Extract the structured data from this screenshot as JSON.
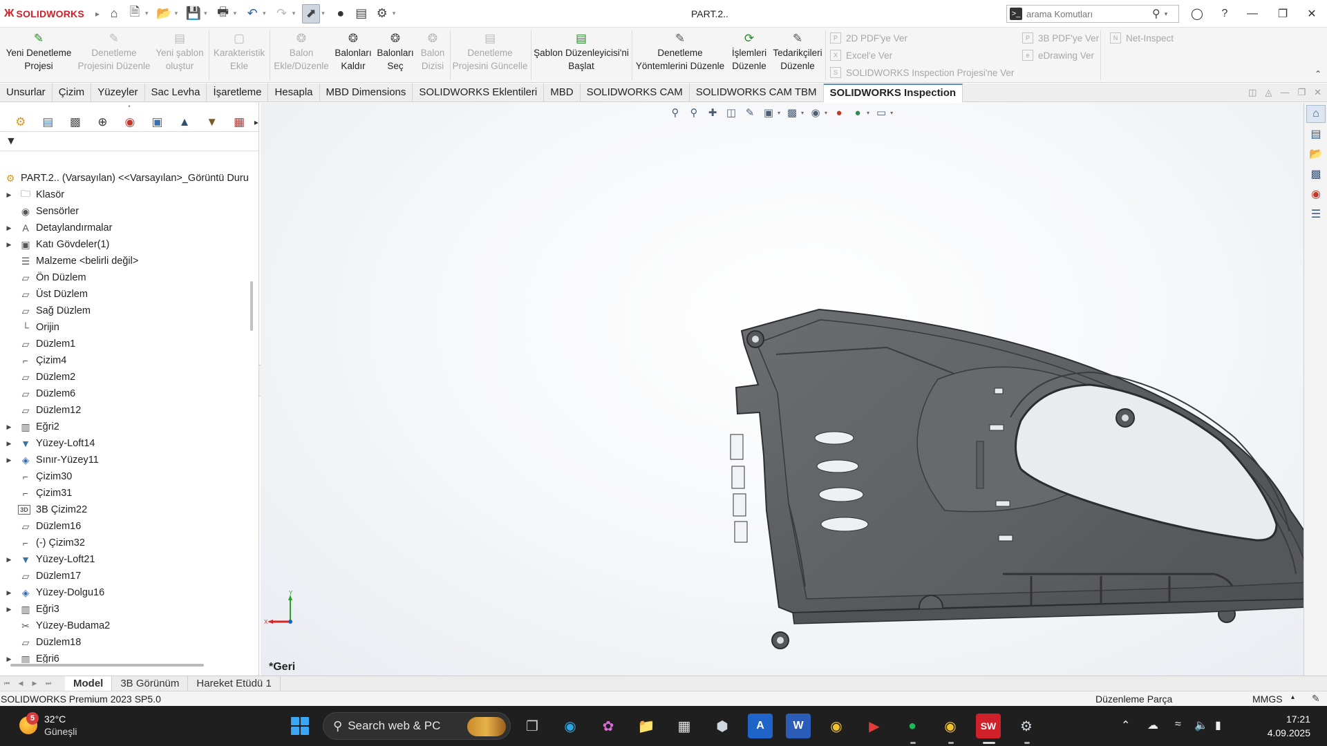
{
  "app": {
    "logo_mark": "Ж",
    "logo_text": "SOLIDWORKS",
    "doc_title": "PART.2..",
    "search_placeholder": "arama Komutları"
  },
  "ribbon": {
    "large_buttons": [
      {
        "label": "Yeni Denetleme Projesi",
        "enabled": true,
        "icon": "new-inspection-project-icon"
      },
      {
        "label": "Denetleme Projesini Düzenle",
        "enabled": false,
        "icon": "edit-inspection-project-icon"
      },
      {
        "label": "Yeni şablon oluştur",
        "enabled": false,
        "icon": "new-template-icon"
      },
      {
        "label": "Karakteristik Ekle",
        "enabled": false,
        "icon": "add-characteristic-icon"
      },
      {
        "label": "Balon Ekle/Düzenle",
        "enabled": false,
        "icon": "balloon-add-icon"
      },
      {
        "label": "Balonları Kaldır",
        "enabled": true,
        "icon": "balloon-remove-icon"
      },
      {
        "label": "Balonları Seç",
        "enabled": true,
        "icon": "balloon-select-icon"
      },
      {
        "label": "Balon Dizisi",
        "enabled": false,
        "icon": "balloon-array-icon"
      },
      {
        "label": "Denetleme Projesini Güncelle",
        "enabled": false,
        "icon": "update-project-icon"
      },
      {
        "label": "Şablon Düzenleyicisi'ni Başlat",
        "enabled": true,
        "icon": "template-editor-icon"
      },
      {
        "label": "Denetleme Yöntemlerini Düzenle",
        "enabled": true,
        "icon": "inspection-methods-icon"
      },
      {
        "label": "İşlemleri Düzenle",
        "enabled": true,
        "icon": "operations-icon"
      },
      {
        "label": "Tedarikçileri Düzenle",
        "enabled": true,
        "icon": "vendors-icon"
      }
    ],
    "small_buttons": [
      {
        "label": "2D PDF'ye Ver"
      },
      {
        "label": "Excel'e Ver"
      },
      {
        "label": "SOLIDWORKS Inspection Projesi'ne Ver"
      },
      {
        "label": "3B PDF'ye Ver"
      },
      {
        "label": "eDrawing Ver"
      },
      {
        "label": "Net-Inspect"
      }
    ]
  },
  "tabs": [
    {
      "label": "Unsurlar",
      "active": false
    },
    {
      "label": "Çizim",
      "active": false
    },
    {
      "label": "Yüzeyler",
      "active": false
    },
    {
      "label": "Sac Levha",
      "active": false
    },
    {
      "label": "İşaretleme",
      "active": false
    },
    {
      "label": "Hesapla",
      "active": false
    },
    {
      "label": "MBD Dimensions",
      "active": false
    },
    {
      "label": "SOLIDWORKS Eklentileri",
      "active": false
    },
    {
      "label": "MBD",
      "active": false
    },
    {
      "label": "SOLIDWORKS CAM",
      "active": false
    },
    {
      "label": "SOLIDWORKS CAM TBM",
      "active": false
    },
    {
      "label": "SOLIDWORKS Inspection",
      "active": true
    }
  ],
  "tree": {
    "root": "PART.2.. (Varsayılan) <<Varsayılan>_Görüntü Duru",
    "items": [
      {
        "label": "Klasör",
        "expandable": true,
        "icon": "folder-icon"
      },
      {
        "label": "Sensörler",
        "expandable": false,
        "icon": "sensor-icon"
      },
      {
        "label": "Detaylandırmalar",
        "expandable": true,
        "icon": "annotations-icon"
      },
      {
        "label": "Katı Gövdeler(1)",
        "expandable": true,
        "icon": "solid-bodies-icon"
      },
      {
        "label": "Malzeme <belirli değil>",
        "expandable": false,
        "icon": "material-icon"
      },
      {
        "label": "Ön Düzlem",
        "expandable": false,
        "icon": "plane-icon"
      },
      {
        "label": "Üst Düzlem",
        "expandable": false,
        "icon": "plane-icon"
      },
      {
        "label": "Sağ Düzlem",
        "expandable": false,
        "icon": "plane-icon"
      },
      {
        "label": "Orijin",
        "expandable": false,
        "icon": "origin-icon"
      },
      {
        "label": "Düzlem1",
        "expandable": false,
        "icon": "plane-icon"
      },
      {
        "label": "Çizim4",
        "expandable": false,
        "icon": "sketch-icon"
      },
      {
        "label": "Düzlem2",
        "expandable": false,
        "icon": "plane-icon"
      },
      {
        "label": "Düzlem6",
        "expandable": false,
        "icon": "plane-icon"
      },
      {
        "label": "Düzlem12",
        "expandable": false,
        "icon": "plane-icon"
      },
      {
        "label": "Eğri2",
        "expandable": true,
        "icon": "curve-icon"
      },
      {
        "label": "Yüzey-Loft14",
        "expandable": true,
        "icon": "surface-loft-icon"
      },
      {
        "label": "Sınır-Yüzey11",
        "expandable": true,
        "icon": "boundary-surface-icon"
      },
      {
        "label": "Çizim30",
        "expandable": false,
        "icon": "sketch-icon"
      },
      {
        "label": "Çizim31",
        "expandable": false,
        "icon": "sketch-icon"
      },
      {
        "label": "3B Çizim22",
        "expandable": false,
        "icon": "3d-sketch-icon",
        "badge": "3D"
      },
      {
        "label": "Düzlem16",
        "expandable": false,
        "icon": "plane-icon"
      },
      {
        "label": "(-) Çizim32",
        "expandable": false,
        "icon": "sketch-icon"
      },
      {
        "label": "Yüzey-Loft21",
        "expandable": true,
        "icon": "surface-loft-icon"
      },
      {
        "label": "Düzlem17",
        "expandable": false,
        "icon": "plane-icon"
      },
      {
        "label": "Yüzey-Dolgu16",
        "expandable": true,
        "icon": "surface-fill-icon"
      },
      {
        "label": "Eğri3",
        "expandable": true,
        "icon": "curve-icon"
      },
      {
        "label": "Yüzey-Budama2",
        "expandable": false,
        "icon": "surface-trim-icon"
      },
      {
        "label": "Düzlem18",
        "expandable": false,
        "icon": "plane-icon"
      },
      {
        "label": "Eğri6",
        "expandable": true,
        "icon": "curve-icon"
      }
    ]
  },
  "viewport": {
    "back_label": "*Geri",
    "triad_y": "Y",
    "triad_x": "X"
  },
  "bottom_tabs": [
    {
      "label": "Model",
      "active": true
    },
    {
      "label": "3B Görünüm",
      "active": false
    },
    {
      "label": "Hareket Etüdü 1",
      "active": false
    }
  ],
  "status": {
    "product": "SOLIDWORKS Premium 2023 SP5.0",
    "mode": "Düzenleme Parça",
    "units": "MMGS",
    "units_dd": "▴"
  },
  "taskbar": {
    "weather_badge": "5",
    "temperature": "32°C",
    "condition": "Güneşli",
    "search_text": "Search web & PC",
    "time": "17:21",
    "date": "4.09.2025"
  }
}
